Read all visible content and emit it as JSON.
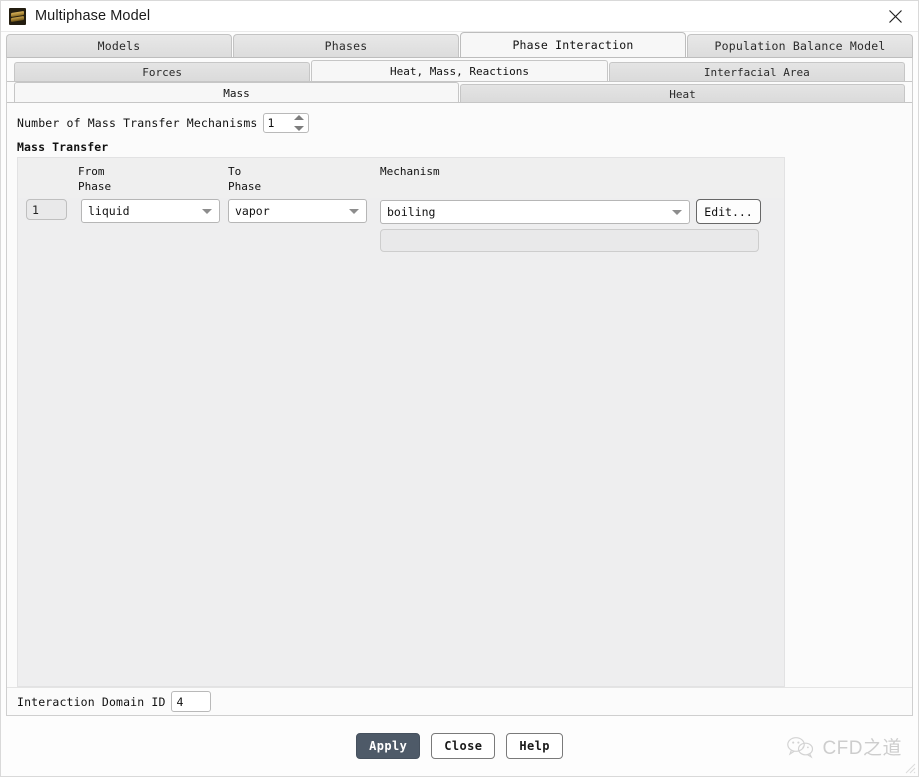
{
  "window": {
    "title": "Multiphase Model",
    "app_icon": "layers-icon",
    "close_icon": "close-icon"
  },
  "tabs_level1": [
    {
      "label": "Models",
      "active": false
    },
    {
      "label": "Phases",
      "active": false
    },
    {
      "label": "Phase Interaction",
      "active": true
    },
    {
      "label": "Population Balance Model",
      "active": false
    }
  ],
  "tabs_level2": [
    {
      "label": "Forces",
      "active": false
    },
    {
      "label": "Heat, Mass, Reactions",
      "active": true
    },
    {
      "label": "Interfacial Area",
      "active": false
    }
  ],
  "tabs_level3": [
    {
      "label": "Mass",
      "active": true
    },
    {
      "label": "Heat",
      "active": false
    }
  ],
  "panel": {
    "mechanism_count_label": "Number of Mass Transfer Mechanisms",
    "mechanism_count_value": "1",
    "section_title": "Mass Transfer",
    "columns": {
      "index": "",
      "from_phase": "From\nPhase",
      "to_phase": "To\nPhase",
      "mechanism": "Mechanism"
    },
    "rows": [
      {
        "index": "1",
        "from_phase": "liquid",
        "to_phase": "vapor",
        "mechanism": "boiling",
        "edit_label": "Edit...",
        "sub_value": ""
      }
    ]
  },
  "bottom": {
    "domain_id_label": "Interaction Domain ID",
    "domain_id_value": "4"
  },
  "footer": {
    "apply_label": "Apply",
    "close_label": "Close",
    "help_label": "Help"
  },
  "watermark": {
    "text": "CFD之道",
    "icon": "wechat-icon"
  },
  "colors": {
    "primary_button": "#4e5a68",
    "panel_gray": "#eeeeef",
    "tab_active": "#f7f7f7",
    "tab_inactive": "#dcdcdc",
    "accent_icon_gold": "#c9a249"
  }
}
